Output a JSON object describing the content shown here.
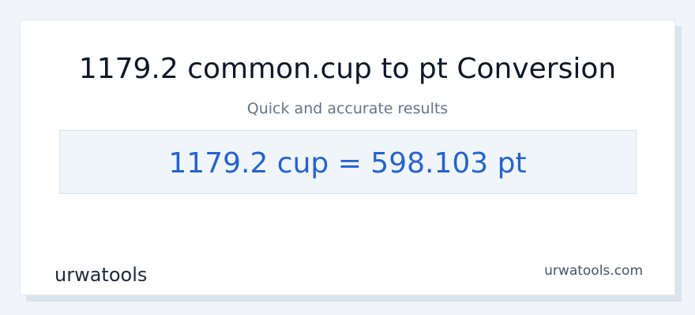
{
  "heading": {
    "title": "1179.2 common.cup to pt Conversion",
    "subtitle": "Quick and accurate results"
  },
  "result": {
    "text": "1179.2 cup = 598.103 pt"
  },
  "footer": {
    "logo_text": "urwatools",
    "site_url": "urwatools.com"
  },
  "colors": {
    "accent": "#2563d0",
    "title": "#0f172a",
    "subtitle": "#64748b"
  }
}
